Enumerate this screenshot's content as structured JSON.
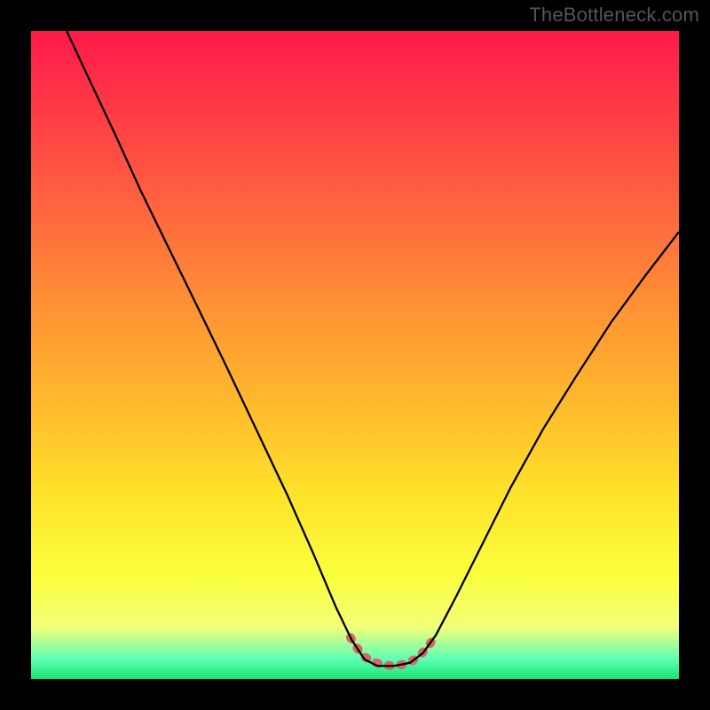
{
  "watermark": "TheBottleneck.com",
  "chart_data": {
    "type": "line",
    "title": "",
    "xlabel": "",
    "ylabel": "",
    "xlim": [
      0,
      1
    ],
    "ylim": [
      0,
      1
    ],
    "background_gradient_stops": [
      {
        "pct": 0,
        "color": "#ff1a4a"
      },
      {
        "pct": 14,
        "color": "#ff3f45"
      },
      {
        "pct": 29,
        "color": "#ff6a3e"
      },
      {
        "pct": 43,
        "color": "#ff9334"
      },
      {
        "pct": 57,
        "color": "#ffb82d"
      },
      {
        "pct": 71,
        "color": "#ffe12a"
      },
      {
        "pct": 84,
        "color": "#fbff3c"
      },
      {
        "pct": 92,
        "color": "#f2ff7a"
      },
      {
        "pct": 97,
        "color": "#5bffb5"
      },
      {
        "pct": 100,
        "color": "#18e36b"
      }
    ],
    "series": [
      {
        "name": "curve",
        "color": "#000000",
        "stroke_width": 2.3,
        "points": [
          {
            "x": 0.055,
            "y": 1.0
          },
          {
            "x": 0.09,
            "y": 0.925
          },
          {
            "x": 0.13,
            "y": 0.84
          },
          {
            "x": 0.17,
            "y": 0.752
          },
          {
            "x": 0.215,
            "y": 0.66
          },
          {
            "x": 0.26,
            "y": 0.568
          },
          {
            "x": 0.305,
            "y": 0.475
          },
          {
            "x": 0.35,
            "y": 0.38
          },
          {
            "x": 0.395,
            "y": 0.285
          },
          {
            "x": 0.435,
            "y": 0.195
          },
          {
            "x": 0.47,
            "y": 0.112
          },
          {
            "x": 0.495,
            "y": 0.06
          },
          {
            "x": 0.515,
            "y": 0.03
          },
          {
            "x": 0.535,
            "y": 0.02
          },
          {
            "x": 0.56,
            "y": 0.02
          },
          {
            "x": 0.585,
            "y": 0.025
          },
          {
            "x": 0.605,
            "y": 0.04
          },
          {
            "x": 0.625,
            "y": 0.068
          },
          {
            "x": 0.655,
            "y": 0.125
          },
          {
            "x": 0.695,
            "y": 0.205
          },
          {
            "x": 0.74,
            "y": 0.295
          },
          {
            "x": 0.79,
            "y": 0.385
          },
          {
            "x": 0.84,
            "y": 0.465
          },
          {
            "x": 0.895,
            "y": 0.55
          },
          {
            "x": 0.95,
            "y": 0.625
          },
          {
            "x": 1.0,
            "y": 0.69
          }
        ]
      },
      {
        "name": "bottom-marks",
        "color": "#d36a63",
        "stroke_width": 10,
        "points": [
          {
            "x": 0.493,
            "y": 0.064
          },
          {
            "x": 0.503,
            "y": 0.048
          },
          {
            "x": 0.515,
            "y": 0.034
          },
          {
            "x": 0.528,
            "y": 0.026
          },
          {
            "x": 0.544,
            "y": 0.022
          },
          {
            "x": 0.558,
            "y": 0.02
          },
          {
            "x": 0.572,
            "y": 0.022
          },
          {
            "x": 0.587,
            "y": 0.027
          },
          {
            "x": 0.6,
            "y": 0.036
          },
          {
            "x": 0.613,
            "y": 0.05
          },
          {
            "x": 0.625,
            "y": 0.068
          }
        ]
      }
    ]
  }
}
